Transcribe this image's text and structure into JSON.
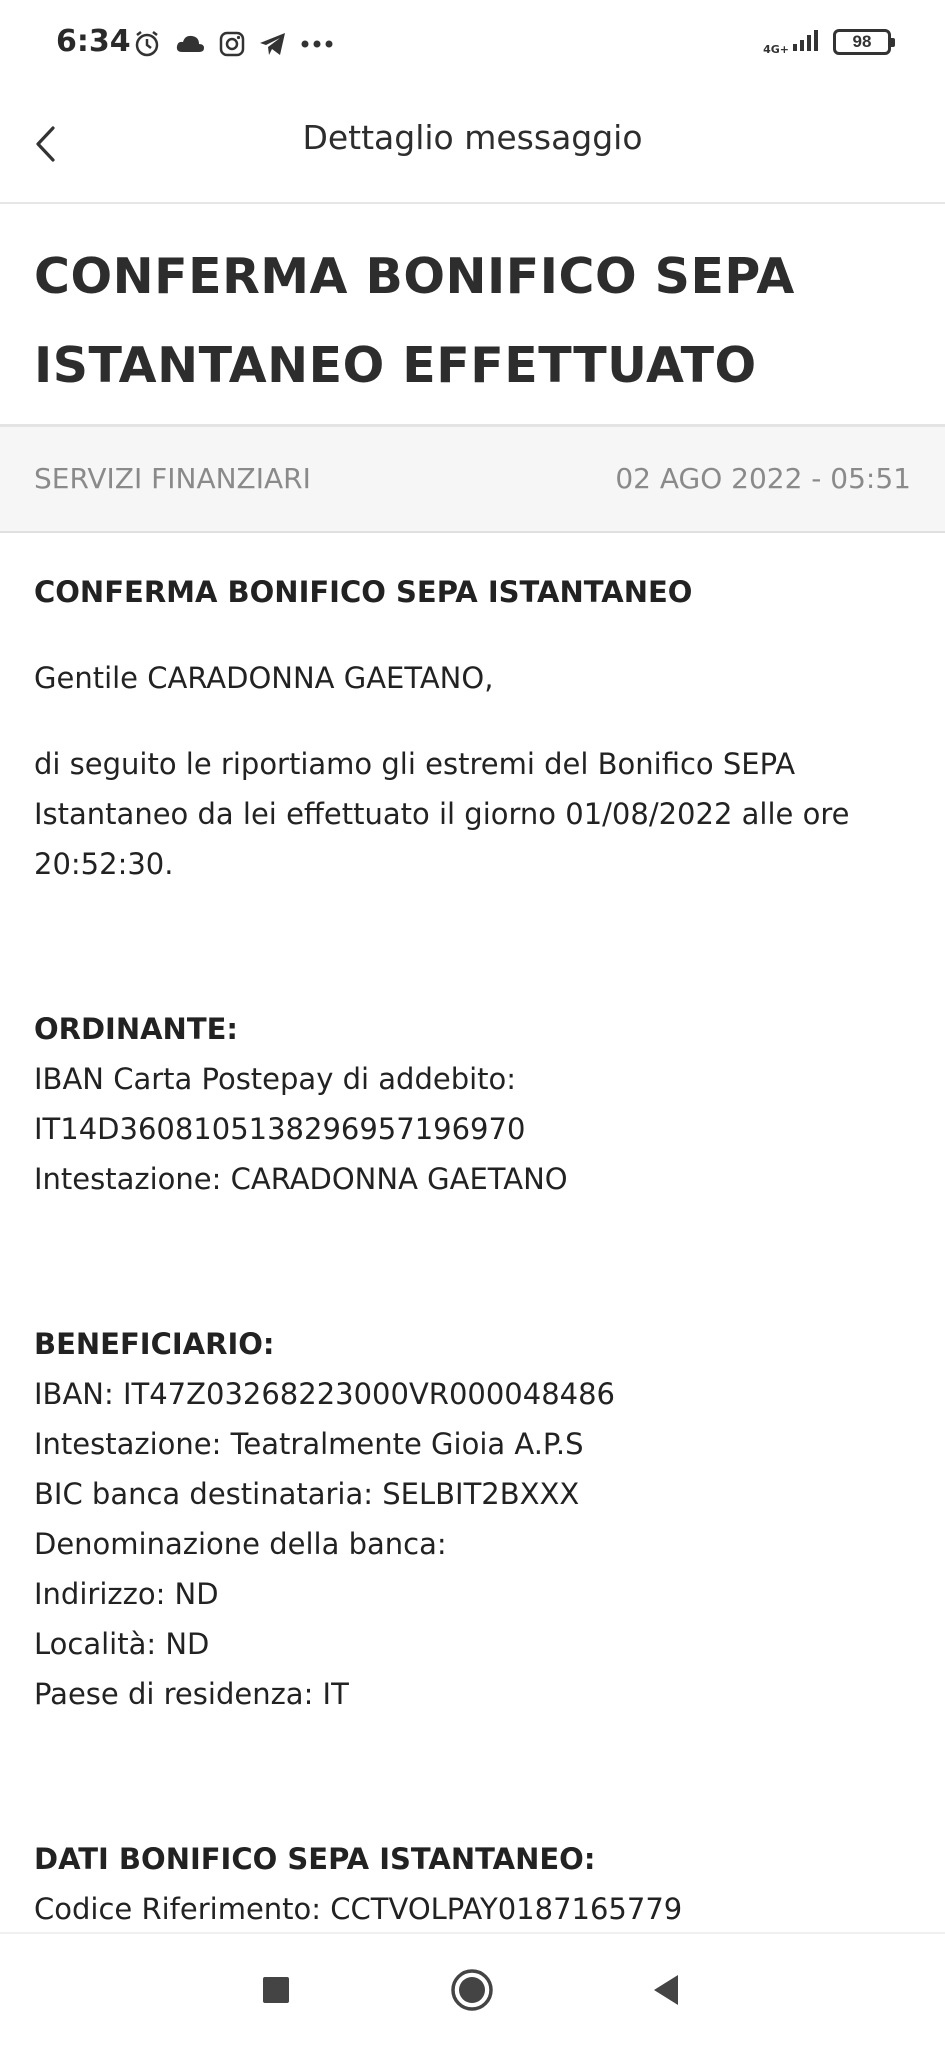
{
  "status_bar": {
    "time": "6:34",
    "icons": [
      "alarm-icon",
      "cloud-icon",
      "instagram-icon",
      "telegram-icon",
      "more-dots-icon"
    ],
    "network": "4G+",
    "battery": "98"
  },
  "header": {
    "title": "Dettaglio messaggio"
  },
  "message": {
    "subject_line1": "CONFERMA BONIFICO SEPA",
    "subject_line2": "ISTANTANEO EFFETTUATO",
    "category": "SERVIZI FINANZIARI",
    "date": "02 AGO 2022 - 05:51",
    "body": {
      "title": "CONFERMA BONIFICO SEPA ISTANTANEO",
      "greeting": "Gentile CARADONNA GAETANO,",
      "intro_line1": "di seguito le riportiamo gli estremi del Bonifico SEPA",
      "intro_line2": "Istantaneo da lei effettuato il giorno 01/08/2022 alle ore",
      "intro_line3": "20:52:30.",
      "ordinante": {
        "heading": "ORDINANTE:",
        "iban_label": "IBAN Carta Postepay di addebito:",
        "iban": "IT14D3608105138296957196970",
        "intestazione": "Intestazione: CARADONNA GAETANO"
      },
      "beneficiario": {
        "heading": "BENEFICIARIO:",
        "iban": "IBAN: IT47Z03268223000VR000048486",
        "intestazione": "Intestazione: Teatralmente Gioia A.P.S",
        "bic": "BIC banca destinataria: SELBIT2BXXX",
        "denominazione": "Denominazione della banca:",
        "indirizzo": "Indirizzo: ND",
        "localita": "Località: ND",
        "paese": "Paese di residenza: IT"
      },
      "dati_bonifico": {
        "heading": "DATI BONIFICO SEPA ISTANTANEO:",
        "codice_riferimento": "Codice Riferimento: CCTVOLPAY0187165779"
      }
    }
  },
  "nav_bar": {
    "buttons": [
      "recents-square-icon",
      "home-circle-icon",
      "back-triangle-icon"
    ]
  },
  "colors": {
    "text_primary": "#222222",
    "text_secondary": "#8a8a8a",
    "meta_background": "#f6f6f6",
    "divider": "#e4e4e4"
  }
}
